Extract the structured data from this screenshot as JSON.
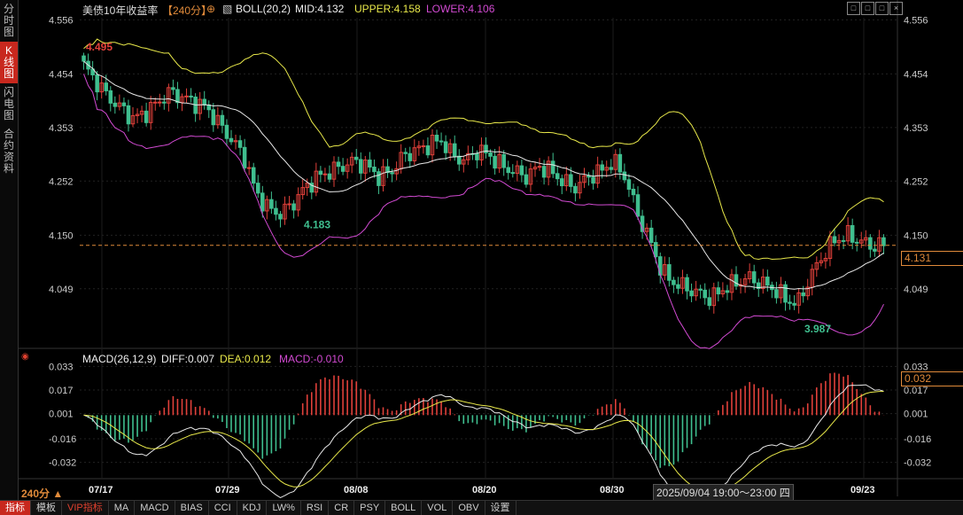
{
  "left_tabs": [
    {
      "label": "分时图",
      "active": false
    },
    {
      "label": "K线图",
      "active": true
    },
    {
      "label": "闪电图",
      "active": false
    },
    {
      "label": "合约资料",
      "active": false
    }
  ],
  "header": {
    "title": "美债10年收益率",
    "period_tag": "【240分】",
    "boll_label": "BOLL(20,2)",
    "mid": "MID:4.132",
    "upper": "UPPER:4.158",
    "lower": "LOWER:4.106"
  },
  "macd_header": {
    "label": "MACD(26,12,9)",
    "diff": "DIFF:0.007",
    "dea": "DEA:0.012",
    "macd": "MACD:-0.010"
  },
  "current_price": "4.131",
  "macd_current": "0.032",
  "crosshair_label": "2025/09/04 19:00～23:00 四",
  "period_selector": "240分 ▲",
  "bottom_tabs": [
    "指标",
    "模板",
    "VIP指标",
    "MA",
    "MACD",
    "BIAS",
    "CCI",
    "KDJ",
    "LW%",
    "RSI",
    "CR",
    "PSY",
    "BOLL",
    "VOL",
    "OBV",
    "设置"
  ],
  "colors": {
    "up": "#e0403a",
    "down": "#3fbf8f",
    "boll_mid": "#e8e8e8",
    "boll_upper": "#e8e84a",
    "boll_lower": "#d24ad2",
    "dea": "#e8e84a",
    "diff": "#e8e8e8",
    "price": "#e08a3a"
  },
  "chart_data": [
    {
      "type": "candlestick",
      "series": "美债10年收益率 240分",
      "ylim": [
        3.95,
        4.56
      ],
      "yticks": [
        "4.556",
        "4.454",
        "4.353",
        "4.252",
        "4.150",
        "4.049"
      ],
      "xticks": [
        "07/17",
        "07/29",
        "08/08",
        "08/20",
        "08/30",
        "09/23"
      ],
      "annotations": [
        {
          "text": "4.495",
          "x": "07/17",
          "value": 4.495
        },
        {
          "text": "4.183",
          "x": "07/26",
          "value": 4.183
        },
        {
          "text": "3.987",
          "x": "09/15",
          "value": 3.987
        }
      ],
      "close_points": [
        4.47,
        4.44,
        4.41,
        4.39,
        4.37,
        4.38,
        4.4,
        4.42,
        4.41,
        4.4,
        4.39,
        4.36,
        4.33,
        4.3,
        4.23,
        4.2,
        4.19,
        4.21,
        4.24,
        4.26,
        4.27,
        4.28,
        4.29,
        4.28,
        4.26,
        4.27,
        4.3,
        4.31,
        4.32,
        4.33,
        4.3,
        4.29,
        4.31,
        4.3,
        4.28,
        4.27,
        4.26,
        4.28,
        4.27,
        4.25,
        4.24,
        4.26,
        4.27,
        4.29,
        4.26,
        4.19,
        4.14,
        4.08,
        4.06,
        4.05,
        4.04,
        4.03,
        4.05,
        4.06,
        4.07,
        4.06,
        4.05,
        4.03,
        4.02,
        4.07,
        4.11,
        4.14,
        4.15,
        4.14,
        4.13,
        4.131
      ],
      "boll": {
        "mid": 4.132,
        "upper": 4.158,
        "lower": 4.106
      }
    },
    {
      "type": "macd",
      "ylim": [
        -0.04,
        0.035
      ],
      "yticks": [
        "0.033",
        "0.017",
        "0.001",
        "-0.016",
        "-0.032"
      ],
      "diff": 0.007,
      "dea": 0.012,
      "macd": -0.01
    }
  ]
}
